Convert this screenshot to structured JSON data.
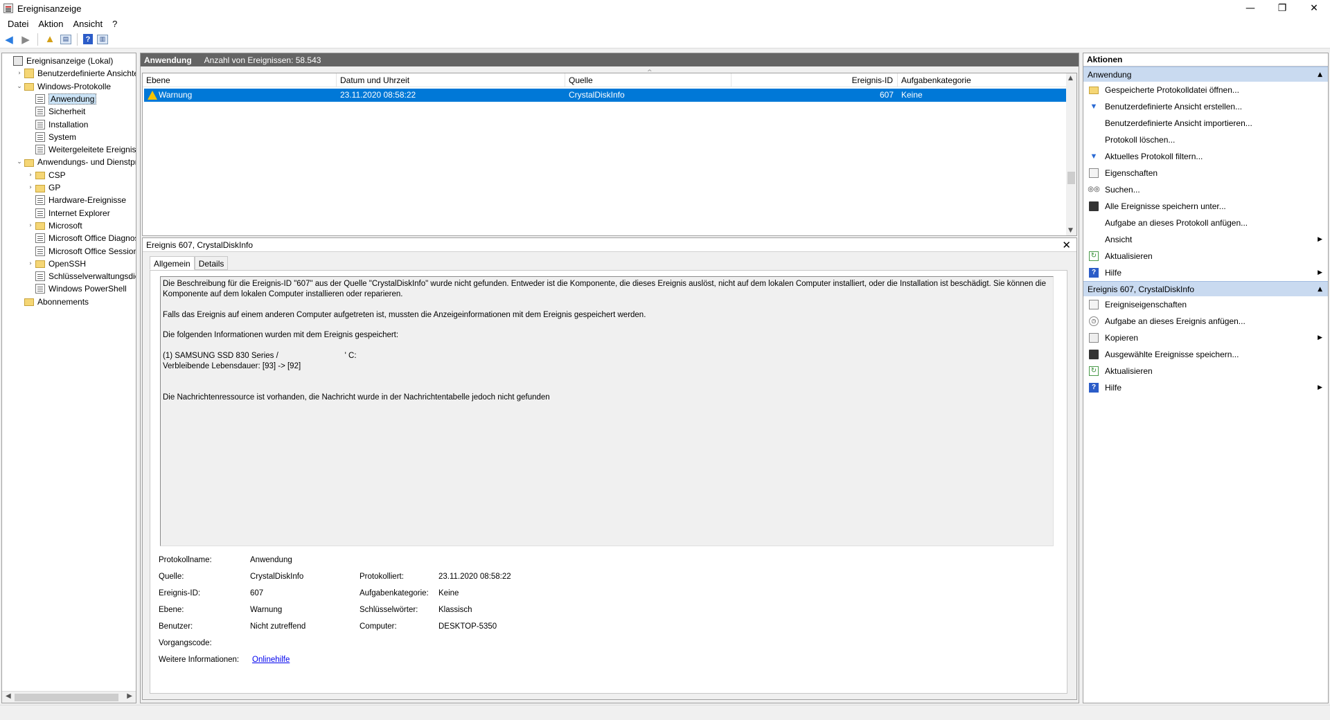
{
  "window": {
    "title": "Ereignisanzeige",
    "minimize": "—",
    "restore": "❐",
    "close": "✕"
  },
  "menu": {
    "items": [
      "Datei",
      "Aktion",
      "Ansicht",
      "?"
    ]
  },
  "tree": {
    "items": [
      {
        "label": "Ereignisanzeige (Lokal)",
        "expander": "",
        "icon": "root-icon",
        "level": 0
      },
      {
        "label": "Benutzerdefinierte Ansichten",
        "expander": "›",
        "icon": "custom-views-icon",
        "level": 1
      },
      {
        "label": "Windows-Protokolle",
        "expander": "⌄",
        "icon": "folder-icon",
        "level": 1
      },
      {
        "label": "Anwendung",
        "expander": "",
        "icon": "log-icon",
        "level": 2,
        "selected": true
      },
      {
        "label": "Sicherheit",
        "expander": "",
        "icon": "log-icon",
        "level": 2
      },
      {
        "label": "Installation",
        "expander": "",
        "icon": "log-icon",
        "level": 2
      },
      {
        "label": "System",
        "expander": "",
        "icon": "log-icon",
        "level": 2
      },
      {
        "label": "Weitergeleitete Ereignisse",
        "expander": "",
        "icon": "log-icon",
        "level": 2
      },
      {
        "label": "Anwendungs- und Dienstprotokolle",
        "expander": "⌄",
        "icon": "folder-icon",
        "level": 1
      },
      {
        "label": "CSP",
        "expander": "›",
        "icon": "folder-icon",
        "level": 2
      },
      {
        "label": "GP",
        "expander": "›",
        "icon": "folder-icon",
        "level": 2
      },
      {
        "label": "Hardware-Ereignisse",
        "expander": "",
        "icon": "log-icon",
        "level": 2
      },
      {
        "label": "Internet Explorer",
        "expander": "",
        "icon": "log-icon",
        "level": 2
      },
      {
        "label": "Microsoft",
        "expander": "›",
        "icon": "folder-icon",
        "level": 2
      },
      {
        "label": "Microsoft Office Diagnostics",
        "expander": "",
        "icon": "log-icon",
        "level": 2
      },
      {
        "label": "Microsoft Office Sessions",
        "expander": "",
        "icon": "log-icon",
        "level": 2
      },
      {
        "label": "OpenSSH",
        "expander": "›",
        "icon": "folder-icon",
        "level": 2
      },
      {
        "label": "Schlüsselverwaltungsdienst",
        "expander": "",
        "icon": "log-icon",
        "level": 2
      },
      {
        "label": "Windows PowerShell",
        "expander": "",
        "icon": "log-icon",
        "level": 2
      },
      {
        "label": "Abonnements",
        "expander": "",
        "icon": "subscriptions-icon",
        "level": 1
      }
    ]
  },
  "center": {
    "header_title": "Anwendung",
    "header_count": "Anzahl von Ereignissen: 58.543",
    "columns": [
      "Ebene",
      "Datum und Uhrzeit",
      "Quelle",
      "Ereignis-ID",
      "Aufgabenkategorie"
    ],
    "rows": [
      {
        "level": "Warnung",
        "datetime": "23.11.2020 08:58:22",
        "source": "CrystalDiskInfo",
        "event_id": "607",
        "category": "Keine"
      }
    ]
  },
  "detail": {
    "title": "Ereignis 607, CrystalDiskInfo",
    "close": "✕",
    "tabs": [
      "Allgemein",
      "Details"
    ],
    "description": [
      "Die Beschreibung für die Ereignis-ID \"607\" aus der Quelle \"CrystalDiskInfo\" wurde nicht gefunden. Entweder ist die Komponente, die dieses Ereignis auslöst, nicht auf dem lokalen Computer installiert, oder die Installation ist beschädigt. Sie können die Komponente auf dem lokalen Computer installieren oder reparieren.",
      "Falls das Ereignis auf einem anderen Computer aufgetreten ist, mussten die Anzeigeinformationen mit dem Ereignis gespeichert werden.",
      "Die folgenden Informationen wurden mit dem Ereignis gespeichert:",
      "(1) SAMSUNG SSD 830 Series /                              ' C:\nVerbleibende Lebensdauer: [93] -> [92]",
      "Die Nachrichtenressource ist vorhanden, die Nachricht wurde in der Nachrichtentabelle jedoch nicht gefunden"
    ],
    "props": {
      "log_name_label": "Protokollname:",
      "log_name": "Anwendung",
      "source_label": "Quelle:",
      "source": "CrystalDiskInfo",
      "logged_label": "Protokolliert:",
      "logged": "23.11.2020 08:58:22",
      "event_id_label": "Ereignis-ID:",
      "event_id": "607",
      "task_label": "Aufgabenkategorie:",
      "task": "Keine",
      "level_label": "Ebene:",
      "level": "Warnung",
      "keywords_label": "Schlüsselwörter:",
      "keywords": "Klassisch",
      "user_label": "Benutzer:",
      "user": "Nicht zutreffend",
      "computer_label": "Computer:",
      "computer": "DESKTOP-5350",
      "opcode_label": "Vorgangscode:",
      "opcode": "",
      "more_info_label": "Weitere Informationen:",
      "more_info_link": "Onlinehilfe"
    }
  },
  "actions": {
    "header": "Aktionen",
    "section1": {
      "title": "Anwendung",
      "items": [
        {
          "label": "Gespeicherte Protokolldatei öffnen...",
          "icon": "open-folder-icon"
        },
        {
          "label": "Benutzerdefinierte Ansicht erstellen...",
          "icon": "create-view-icon"
        },
        {
          "label": "Benutzerdefinierte Ansicht importieren...",
          "icon": ""
        },
        {
          "label": "Protokoll löschen...",
          "icon": ""
        },
        {
          "label": "Aktuelles Protokoll filtern...",
          "icon": "filter-icon"
        },
        {
          "label": "Eigenschaften",
          "icon": "properties-icon"
        },
        {
          "label": "Suchen...",
          "icon": "find-icon"
        },
        {
          "label": "Alle Ereignisse speichern unter...",
          "icon": "save-icon"
        },
        {
          "label": "Aufgabe an dieses Protokoll anfügen...",
          "icon": ""
        },
        {
          "label": "Ansicht",
          "icon": "",
          "submenu": true
        },
        {
          "label": "Aktualisieren",
          "icon": "refresh-icon"
        },
        {
          "label": "Hilfe",
          "icon": "help-icon",
          "submenu": true
        }
      ]
    },
    "section2": {
      "title": "Ereignis 607, CrystalDiskInfo",
      "items": [
        {
          "label": "Ereigniseigenschaften",
          "icon": "properties-icon"
        },
        {
          "label": "Aufgabe an dieses Ereignis anfügen...",
          "icon": "task-icon"
        },
        {
          "label": "Kopieren",
          "icon": "copy-icon",
          "submenu": true
        },
        {
          "label": "Ausgewählte Ereignisse speichern...",
          "icon": "save-icon"
        },
        {
          "label": "Aktualisieren",
          "icon": "refresh-icon"
        },
        {
          "label": "Hilfe",
          "icon": "help-icon",
          "submenu": true
        }
      ]
    }
  }
}
